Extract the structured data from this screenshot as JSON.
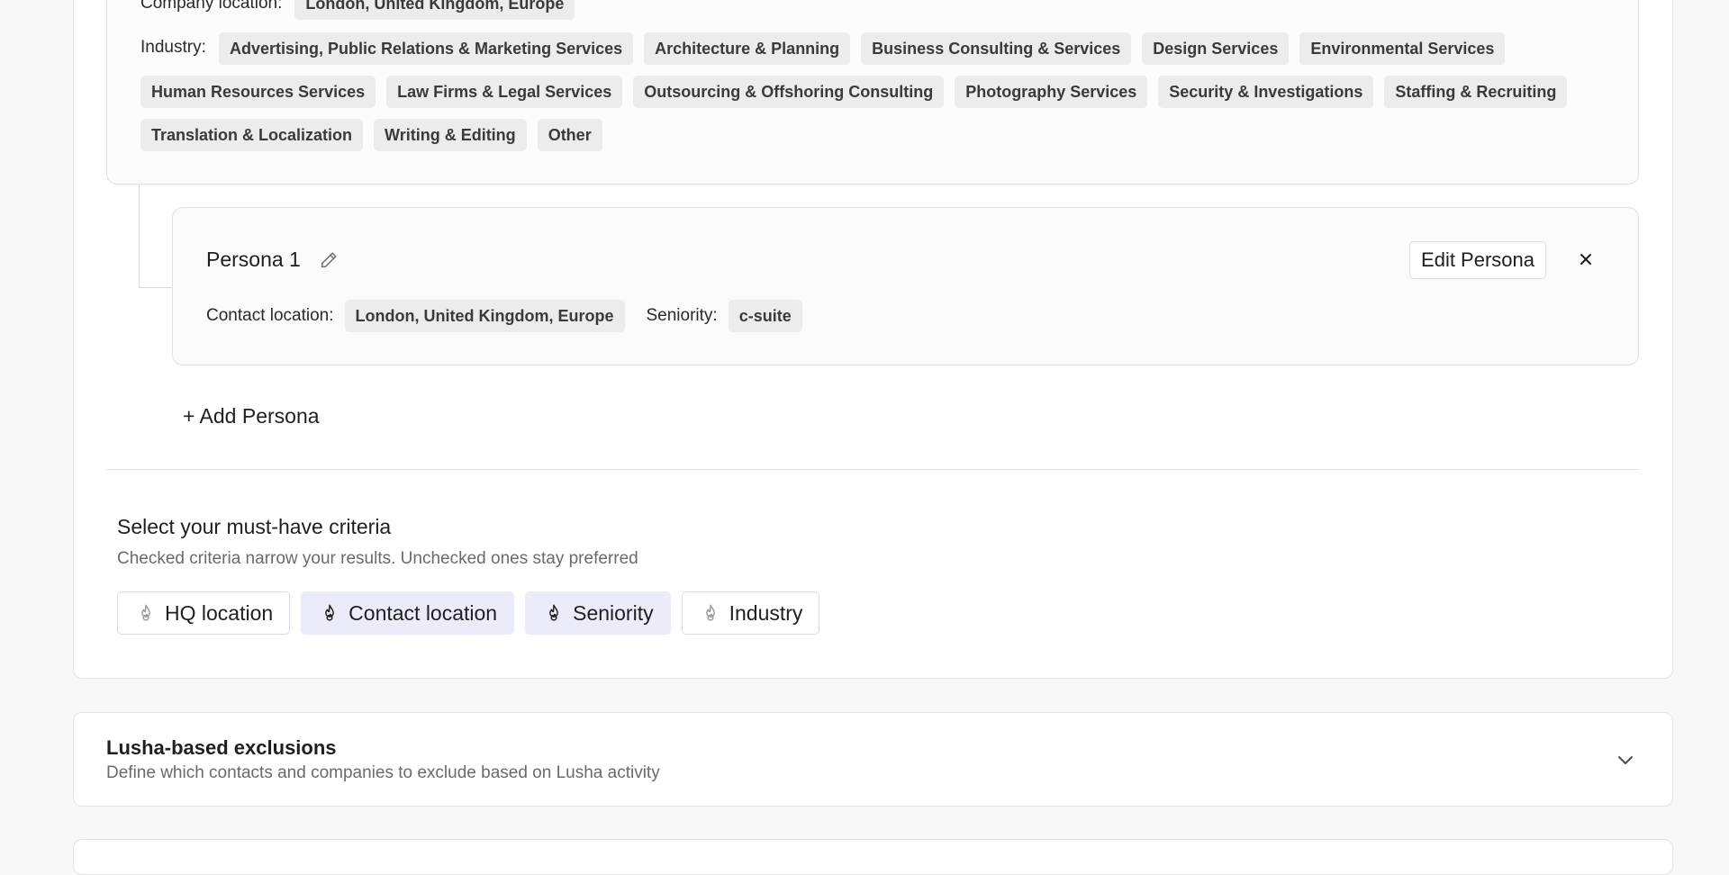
{
  "company": {
    "partial_label": "Company location:",
    "partial_value": "London, United Kingdom, Europe",
    "industry_label": "Industry:",
    "industries_row1": [
      "Advertising, Public Relations & Marketing Services",
      "Architecture & Planning",
      "Business Consulting & Services",
      "Design Services",
      "Environmental Services"
    ],
    "industries_row2": [
      "Human Resources Services",
      "Law Firms & Legal Services",
      "Outsourcing & Offshoring Consulting",
      "Photography Services",
      "Security & Investigations",
      "Staffing & Recruiting"
    ],
    "industries_row3": [
      "Translation & Localization",
      "Writing & Editing",
      "Other"
    ]
  },
  "persona": {
    "title": "Persona 1",
    "edit_label": "Edit Persona",
    "contact_location_label": "Contact location:",
    "contact_location_value": "London, United Kingdom, Europe",
    "seniority_label": "Seniority:",
    "seniority_value": "c-suite",
    "icons": [
      "pencil-icon",
      "close-icon"
    ]
  },
  "add_persona_label": "+ Add Persona",
  "criteria": {
    "title": "Select your must-have criteria",
    "subtitle": "Checked criteria narrow your results. Unchecked ones stay preferred",
    "items": [
      {
        "label": "HQ location",
        "checked": false
      },
      {
        "label": "Contact location",
        "checked": true
      },
      {
        "label": "Seniority",
        "checked": true
      },
      {
        "label": "Industry",
        "checked": false
      }
    ]
  },
  "exclusions": {
    "title": "Lusha-based exclusions",
    "subtitle": "Define which contacts and companies to exclude based on Lusha activity",
    "icon": "chevron-down-icon"
  },
  "colors": {
    "chip_bg": "#ececec",
    "criteria_checked_bg": "#ebebfa",
    "page_bg": "#f8f8f8"
  }
}
